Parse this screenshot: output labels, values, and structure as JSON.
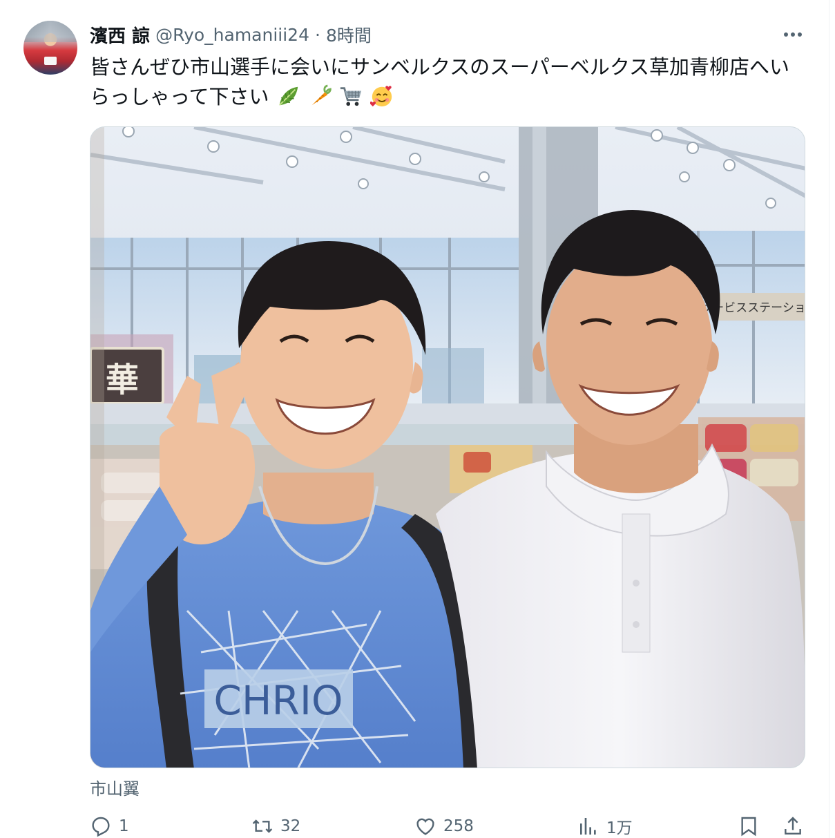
{
  "tweet": {
    "display_name": "濱西 諒",
    "handle": "@Ryo_hamaniii24",
    "separator": "·",
    "time": "8時間",
    "text": "皆さんぜひ市山選手に会いにサンベルクスのスーパーベルクス草加青柳店へいらっしゃって下さい",
    "emojis": [
      "leafy-green-icon",
      "carrot-icon",
      "shopping-cart-icon",
      "smiling-face-with-hearts-icon"
    ],
    "photo_tag": "市山翼",
    "shirt_print": "CHRIO",
    "store_sign": "華",
    "store_banner": "サービスステーション"
  },
  "actions": {
    "replies": "1",
    "retweets": "32",
    "likes": "258",
    "views": "1万"
  },
  "colors": {
    "text_primary": "#0f1419",
    "text_secondary": "#536471",
    "border": "#cfd9de"
  }
}
